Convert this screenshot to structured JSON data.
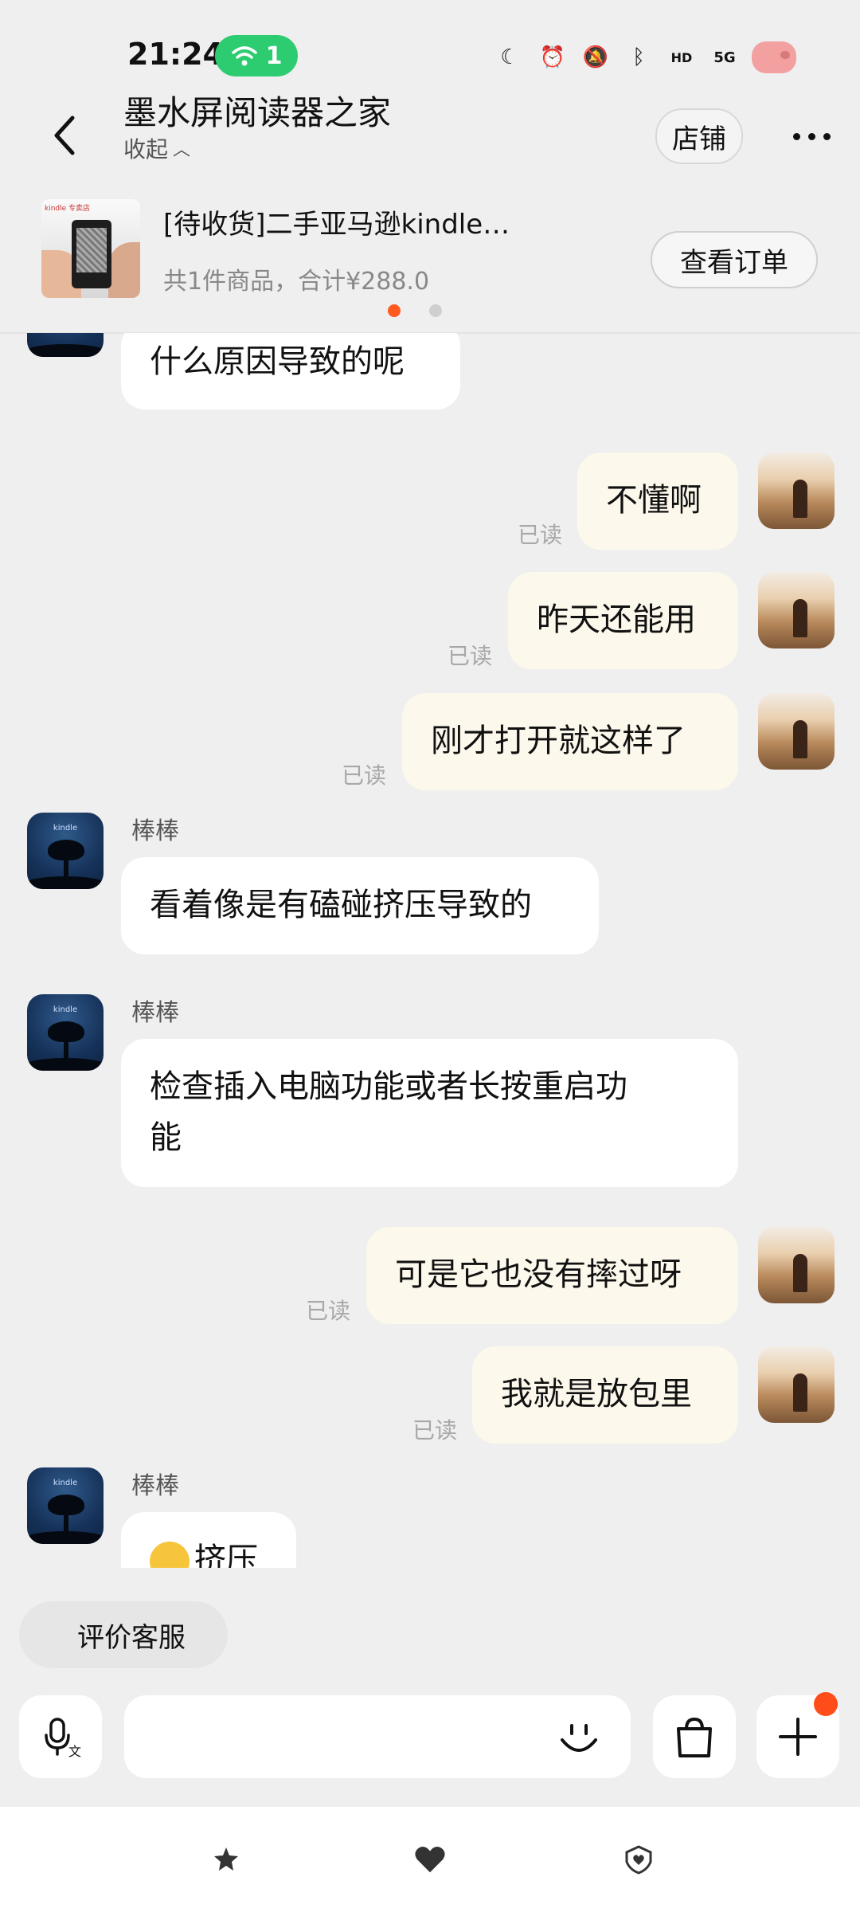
{
  "status_bar": {
    "time": "21:24",
    "wifi_badge": "1",
    "network": "5G"
  },
  "header": {
    "title": "墨水屏阅读器之家",
    "collapse_label": "收起",
    "store_label": "店铺"
  },
  "order": {
    "title": "[待收货]二手亚马逊kindle…",
    "summary": "共1件商品，合计¥288.0",
    "view_button": "查看订单",
    "thumb_text": "kindle 专卖店"
  },
  "messages": [
    {
      "from": "them",
      "sender": "",
      "text": "什么原因导致的呢"
    },
    {
      "from": "me",
      "read": "已读",
      "text": "不懂啊"
    },
    {
      "from": "me",
      "read": "已读",
      "text": "昨天还能用"
    },
    {
      "from": "me",
      "read": "已读",
      "text": "刚才打开就这样了"
    },
    {
      "from": "them",
      "sender": "棒棒",
      "text": "看着像是有磕碰挤压导致的"
    },
    {
      "from": "them",
      "sender": "棒棒",
      "line1": "检查插入电脑功能或者长按重启功",
      "line2": "能"
    },
    {
      "from": "me",
      "read": "已读",
      "text": "可是它也没有摔过呀"
    },
    {
      "from": "me",
      "read": "已读",
      "text": "我就是放包里"
    },
    {
      "from": "them",
      "sender": "棒棒",
      "text": "挤压"
    }
  ],
  "avatar_brand": "kindle",
  "bottom": {
    "eval_chip": "评价客服",
    "input_placeholder": ""
  },
  "colors": {
    "accent": "#ff5a1f",
    "my_bubble": "#fdf8ec",
    "their_bubble": "#ffffff",
    "wifi_badge": "#2ecc71"
  }
}
